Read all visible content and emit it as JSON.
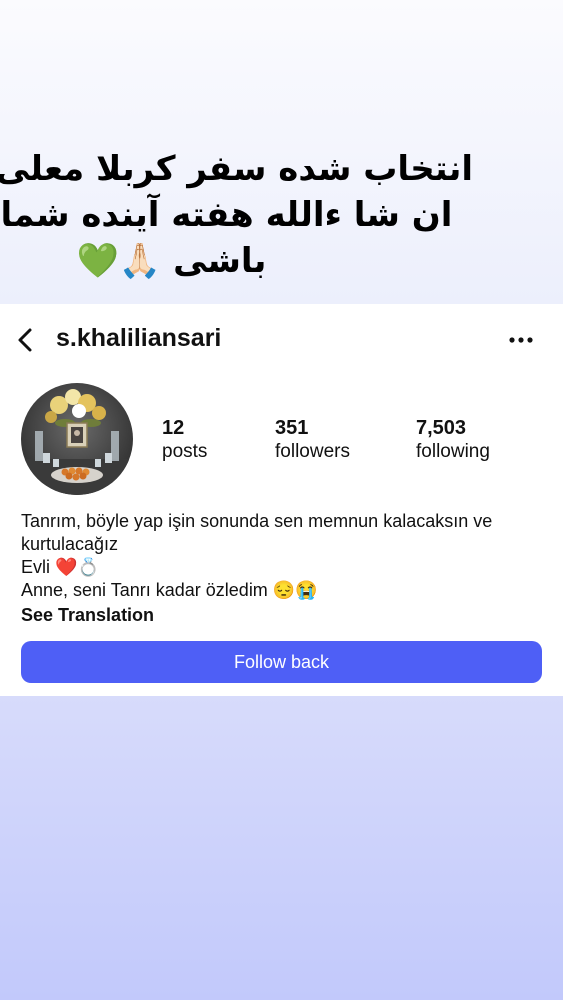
{
  "caption": {
    "line1": "انتخاب شده سفر کربلا معلی",
    "line2": "ان شا ءالله هفته آینده شما",
    "line3": "باشی 🙏🏻💚"
  },
  "header": {
    "back_icon": "chevron-left-icon",
    "username": "s.khaliliansari",
    "more_icon": "ellipsis-icon"
  },
  "stats": {
    "posts": {
      "count": "12",
      "label": "posts"
    },
    "followers": {
      "count": "351",
      "label": "followers"
    },
    "following": {
      "count": "7,503",
      "label": "following"
    }
  },
  "bio": {
    "line1": "Tanrım, böyle yap işin sonunda sen memnun kalacaksın ve kurtulacağız",
    "line2": "Evli ❤️💍",
    "line3": "Anne, seni Tanrı kadar özledim 😔😭",
    "see_translation": "See Translation"
  },
  "actions": {
    "follow_back": "Follow back"
  },
  "colors": {
    "accent": "#4e5ff6",
    "background_top": "#eceffc",
    "background_bottom": "#c2c9fb"
  }
}
